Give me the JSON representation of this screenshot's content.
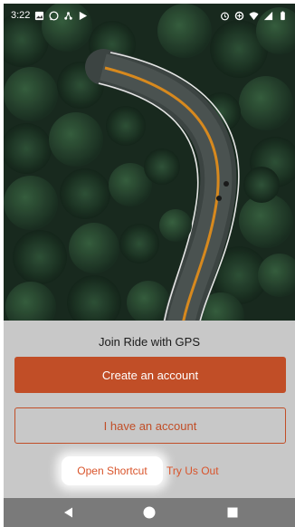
{
  "status_bar": {
    "time": "3:22",
    "left_icons": [
      "gallery-icon",
      "whatsapp-icon",
      "share-icon",
      "play-store-icon"
    ],
    "right_icons": [
      "alarm-icon",
      "data-saver-icon",
      "wifi-icon",
      "signal-icon",
      "battery-icon"
    ]
  },
  "hero": {
    "description_icon": "forest-road-photo",
    "colors": {
      "forest_dark": "#142219",
      "forest_mid": "#23402c",
      "road": "#3c4442",
      "center_line": "#d7891e",
      "edge_line": "#e6e6e6"
    }
  },
  "sheet": {
    "title": "Join Ride with GPS",
    "create_account_label": "Create an account",
    "have_account_label": "I have an account",
    "open_shortcut_label": "Open Shortcut",
    "try_us_out_label": "Try Us Out",
    "colors": {
      "accent": "#c14e27",
      "background": "#c8c8c8",
      "link": "#d9542b"
    }
  },
  "nav_bar": {
    "icons": [
      "back-icon",
      "home-icon",
      "recents-icon"
    ]
  }
}
